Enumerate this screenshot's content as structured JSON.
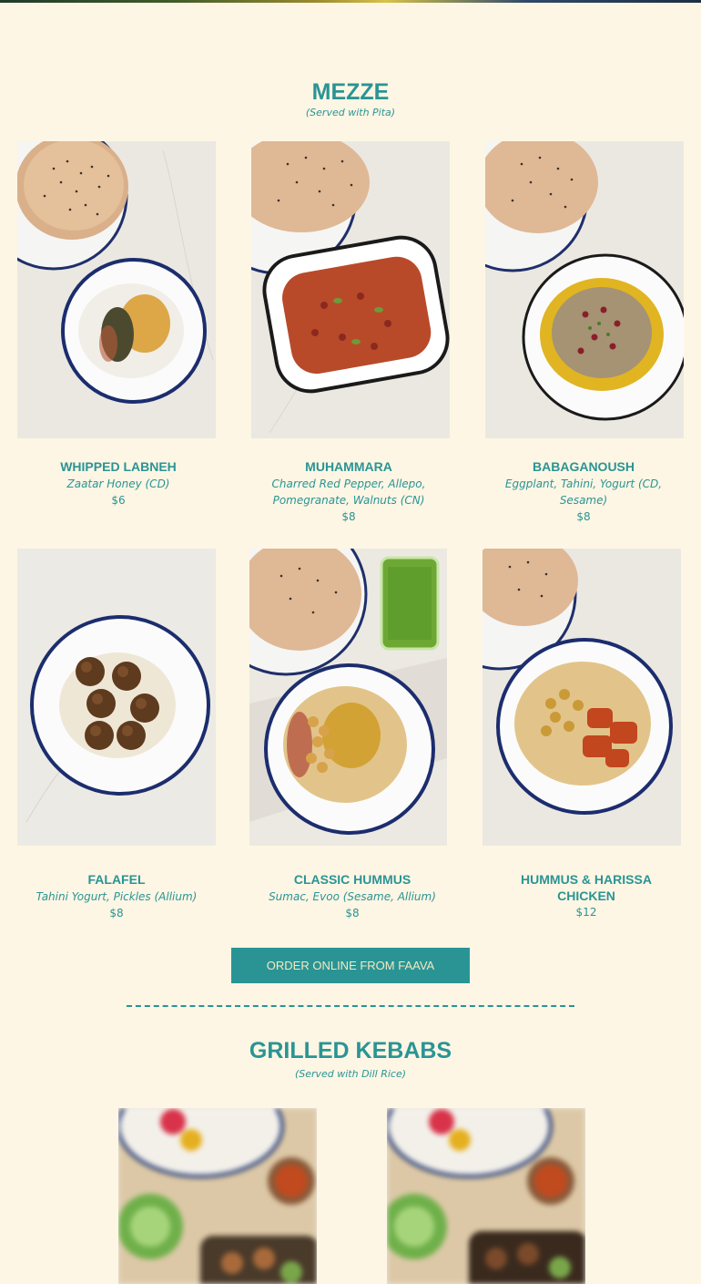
{
  "mezze": {
    "title": "MEZZE",
    "subtitle": "(Served with Pita)",
    "items": [
      {
        "name": "WHIPPED LABNEH",
        "desc": "Zaatar Honey (CD)",
        "price": "$6"
      },
      {
        "name": "MUHAMMARA",
        "desc": "Charred Red Pepper, Allepo, Pomegranate, Walnuts (CN)",
        "price": "$8"
      },
      {
        "name": "BABAGANOUSH",
        "desc": "Eggplant, Tahini, Yogurt (CD, Sesame)",
        "price": "$8"
      },
      {
        "name": "FALAFEL",
        "desc": "Tahini Yogurt, Pickles (Allium)",
        "price": "$8"
      },
      {
        "name": "CLASSIC HUMMUS",
        "desc": "Sumac, Evoo (Sesame, Allium)",
        "price": "$8"
      },
      {
        "name": "HUMMUS & HARISSA CHICKEN",
        "desc": "",
        "price": "$12"
      }
    ]
  },
  "order_button": {
    "label": "ORDER ONLINE FROM FAAVA"
  },
  "kebabs": {
    "title": "GRILLED KEBABS",
    "subtitle": "(Served with Dill Rice)"
  },
  "colors": {
    "background": "#fdf6e4",
    "accent": "#2a9494",
    "button_text": "#f4e9c2"
  }
}
